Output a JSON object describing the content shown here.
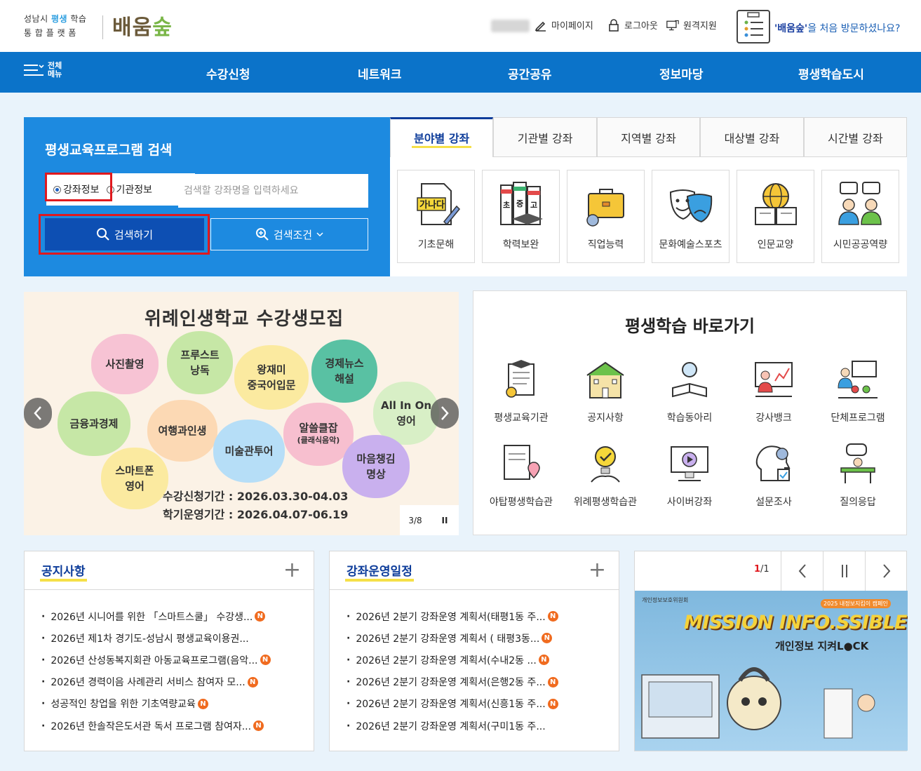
{
  "header": {
    "logo_line1_a": "성남시",
    "logo_line1_hl": "평생",
    "logo_line1_b": "학습",
    "logo_line2": "통 합 플 랫 폼",
    "logo_main": "배움",
    "logo_leaf": "숲",
    "mypage": "마이페이지",
    "logout": "로그아웃",
    "remote": "원격지원",
    "visit_brand": "'배움숲'",
    "visit_text": "을 처음 방문하셨나요?"
  },
  "nav": {
    "menu_line1": "전체",
    "menu_line2": "메뉴",
    "items": [
      "수강신청",
      "네트워크",
      "공간공유",
      "정보마당",
      "평생학습도시"
    ]
  },
  "search": {
    "title": "평생교육프로그램 검색",
    "radio_course": "강좌정보",
    "radio_org": "기관정보",
    "placeholder": "검색할 강좌명을 입력하세요",
    "search_button": "검색하기",
    "condition_button": "검색조건"
  },
  "categories": {
    "tabs": [
      "분야별 강좌",
      "기관별 강좌",
      "지역별 강좌",
      "대상별 강좌",
      "시간별 강좌"
    ],
    "items": [
      "기초문해",
      "학력보완",
      "직업능력",
      "문화예술스포츠",
      "인문교양",
      "시민공공역량"
    ],
    "icon_text_1": "가나다",
    "icon_text_2a": "초",
    "icon_text_2b": "중",
    "icon_text_2c": "고"
  },
  "banner": {
    "title": "위례인생학교 수강생모집",
    "flowers": [
      "사진촬영",
      "프루스트\n낭독",
      "왕재미\n중국어입문",
      "경제뉴스\n해설",
      "All In On\n영어",
      "금융과경제",
      "여행과인생",
      "미술관투어",
      "알쓸클잡",
      "(클래식음악)",
      "마음챙김\n명상",
      "스마트폰\n영어"
    ],
    "date1": "수강신청기간 : 2026.03.30-04.03",
    "date2": "학기운영기간 : 2026.04.07-06.19",
    "counter": "3/8",
    "pause": "II"
  },
  "quick": {
    "title": "평생학습 바로가기",
    "items": [
      "평생교육기관",
      "공지사항",
      "학습동아리",
      "강사뱅크",
      "단체프로그램",
      "야탑평생학습관",
      "위례평생학습관",
      "사이버강좌",
      "설문조사",
      "질의응답"
    ]
  },
  "notice": {
    "title": "공지사항",
    "plus": "+",
    "items": [
      {
        "text": "2026년 시니어를 위한 「스마트스쿨」 수강생...",
        "new": true
      },
      {
        "text": "2026년 제1차 경기도-성남시 평생교육이용권...",
        "new": false
      },
      {
        "text": "2026년 산성동복지회관 아동교육프로그램(음악...",
        "new": true
      },
      {
        "text": "2026년 경력이음 사례관리 서비스 참여자 모...",
        "new": true
      },
      {
        "text": "성공적인 창업을 위한 기초역량교육",
        "new": true
      },
      {
        "text": "2026년 한솔작은도서관 독서 프로그램 참여자...",
        "new": true
      }
    ]
  },
  "schedule": {
    "title": "강좌운영일정",
    "plus": "+",
    "items": [
      {
        "text": "2026년 2분기 강좌운영 계획서(태평1동 주...",
        "new": true
      },
      {
        "text": "2026년 2분기 강좌운영 계획서 ( 태평3동...",
        "new": true
      },
      {
        "text": "2026년 2분기 강좌운영 계획서(수내2동 ...",
        "new": true
      },
      {
        "text": "2026년 2분기 강좌운영 계획서(은행2동 주...",
        "new": true
      },
      {
        "text": "2026년 2분기 강좌운영 계획서(신흥1동 주...",
        "new": true
      },
      {
        "text": "2026년 2분기 강좌운영 계획서(구미1동 주...",
        "new": false
      }
    ]
  },
  "promo": {
    "count_current": "1",
    "count_total": "/1",
    "title": "MISSION INFO.SSIBLE",
    "subtitle": "개인정보 지켜L●CK",
    "tag": "2025 내정보지킴이 캠페인",
    "org": "개인정보보호위원회",
    "badge": "N"
  },
  "colors": {
    "nav": "#0b73c9",
    "search_panel": "#1d8ae0",
    "search_button": "#0d4fb3",
    "highlight_box": "#e0191e",
    "new_badge": "#f06b1f"
  }
}
